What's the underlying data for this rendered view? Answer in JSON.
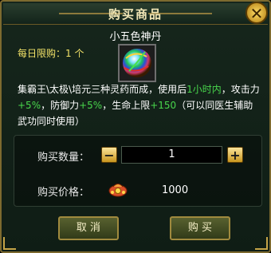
{
  "dialog": {
    "title": "购买商品",
    "close_glyph": "✕"
  },
  "item": {
    "name": "小五色神丹",
    "daily_limit": "每日限购：1 个",
    "icon": "multicolor-pill-icon",
    "description": {
      "text1": "集霸王\\太极\\培元三种灵药而成，使用后",
      "duration": "1小时内",
      "text2": "，攻击力",
      "atk": "+5%",
      "text3": "，防御力",
      "def": "+5%",
      "text4": "，生命上限",
      "hp": "+150",
      "text5": "（可以同医生辅助武功同时使用）"
    }
  },
  "purchase": {
    "qty_label": "购买数量：",
    "qty_value": "1",
    "minus": "−",
    "plus": "+",
    "price_label": "购买价格：",
    "price_value": "1000",
    "currency_icon": "money-pouch-icon"
  },
  "buttons": {
    "cancel": "取 消",
    "buy": "购 买"
  },
  "colors": {
    "highlight": "#48d64c",
    "limit_text": "#f2e268",
    "title_text": "#f1e6b6"
  }
}
